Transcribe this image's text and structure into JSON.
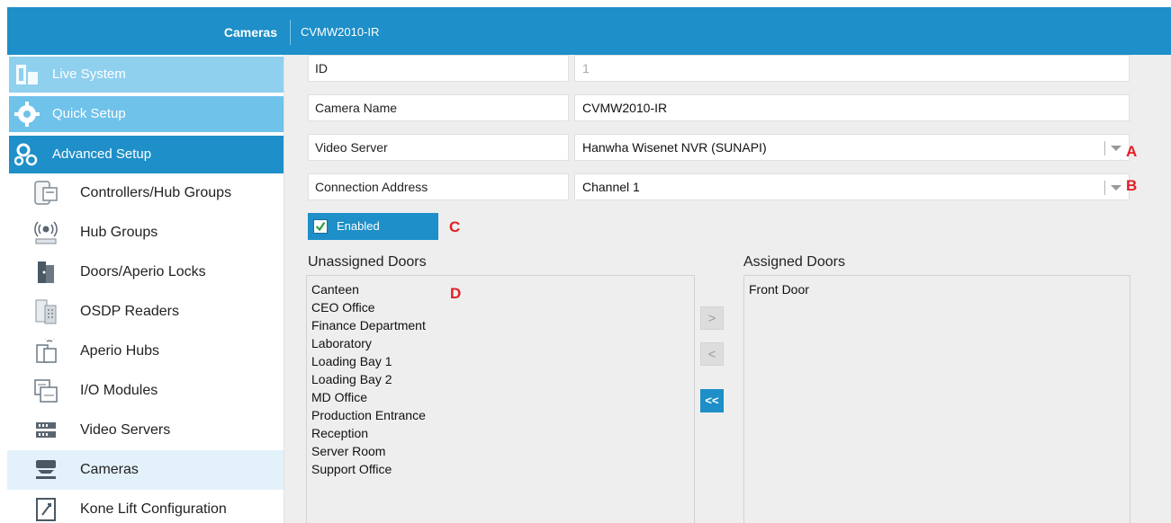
{
  "header": {
    "module_title": "Cameras",
    "record_title": "CVMW2010-IR"
  },
  "sidebar": {
    "sections": [
      {
        "label": "Live System",
        "icon": "live-system-icon"
      },
      {
        "label": "Quick Setup",
        "icon": "gear-icon"
      },
      {
        "label": "Advanced Setup",
        "icon": "gears-icon"
      }
    ],
    "items": [
      {
        "label": "Controllers/Hub Groups",
        "icon": "controller-icon"
      },
      {
        "label": "Hub Groups",
        "icon": "wireless-hub-icon"
      },
      {
        "label": "Doors/Aperio Locks",
        "icon": "door-icon"
      },
      {
        "label": "OSDP Readers",
        "icon": "card-reader-icon"
      },
      {
        "label": "Aperio Hubs",
        "icon": "aperio-hub-icon"
      },
      {
        "label": "I/O Modules",
        "icon": "io-module-icon"
      },
      {
        "label": "Video Servers",
        "icon": "video-server-icon"
      },
      {
        "label": "Cameras",
        "icon": "camera-icon",
        "active": true
      },
      {
        "label": "Kone Lift Configuration",
        "icon": "lift-icon"
      }
    ]
  },
  "form": {
    "id": {
      "label": "ID",
      "value": "1"
    },
    "camera_name": {
      "label": "Camera Name",
      "value": "CVMW2010-IR"
    },
    "video_server": {
      "label": "Video Server",
      "value": "Hanwha Wisenet NVR (SUNAPI)",
      "marker": "A"
    },
    "connection_address": {
      "label": "Connection Address",
      "value": "Channel 1",
      "marker": "B"
    },
    "enabled": {
      "label": "Enabled",
      "checked": true,
      "marker": "C"
    }
  },
  "unassigned": {
    "title": "Unassigned Doors",
    "marker": "D",
    "doors": [
      "Canteen",
      "CEO Office",
      "Finance Department",
      "Laboratory",
      "Loading Bay 1",
      "Loading Bay 2",
      "MD Office",
      "Production Entrance",
      "Reception",
      "Server Room",
      "Support Office"
    ]
  },
  "assigned": {
    "title": "Assigned Doors",
    "doors": [
      "Front Door"
    ]
  },
  "move_buttons": {
    "assign": ">",
    "unassign": "<",
    "unassign_all": "<<"
  },
  "colors": {
    "accent": "#1e8fc8",
    "marker": "#e31e24",
    "panel": "#eeeeee"
  }
}
